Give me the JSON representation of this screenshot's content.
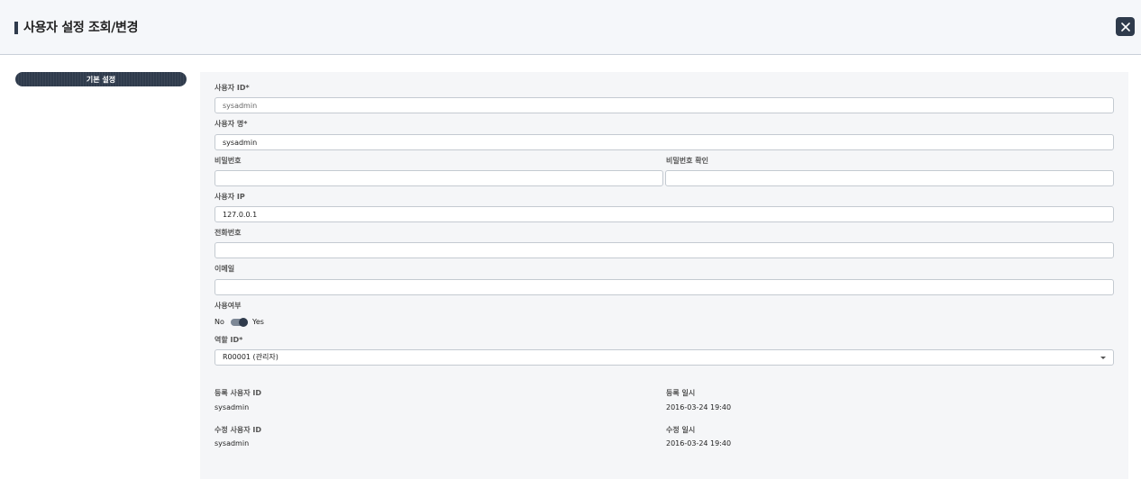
{
  "header": {
    "title": "사용자 설정 조회/변경"
  },
  "sidebar": {
    "tab_label": "기본 설정"
  },
  "form": {
    "user_id": {
      "label": "사용자 ID*",
      "value": "sysadmin"
    },
    "user_name": {
      "label": "사용자 명*",
      "value": "sysadmin"
    },
    "password": {
      "label": "비밀번호",
      "value": ""
    },
    "password_confirm": {
      "label": "비밀번호 확인",
      "value": ""
    },
    "user_ip": {
      "label": "사용자 IP",
      "value": "127.0.0.1"
    },
    "phone": {
      "label": "전화번호",
      "value": ""
    },
    "email": {
      "label": "이메일",
      "value": ""
    },
    "use_flag": {
      "label": "사용여부",
      "off_label": "No",
      "on_label": "Yes",
      "checked": true
    },
    "role_id": {
      "label": "역할 ID*",
      "selected": "R00001 (관리자)"
    }
  },
  "meta": {
    "reg_user": {
      "label": "등록 사용자 ID",
      "value": "sysadmin"
    },
    "reg_date": {
      "label": "등록 일시",
      "value": "2016-03-24 19:40"
    },
    "mod_user": {
      "label": "수정 사용자 ID",
      "value": "sysadmin"
    },
    "mod_date": {
      "label": "수정 일시",
      "value": "2016-03-24 19:40"
    }
  },
  "colors": {
    "primary": "#2f3b4c",
    "panel_bg": "#f5f6f8",
    "header_bg": "#f5f7fa"
  },
  "icons": {
    "close": "close-icon"
  }
}
